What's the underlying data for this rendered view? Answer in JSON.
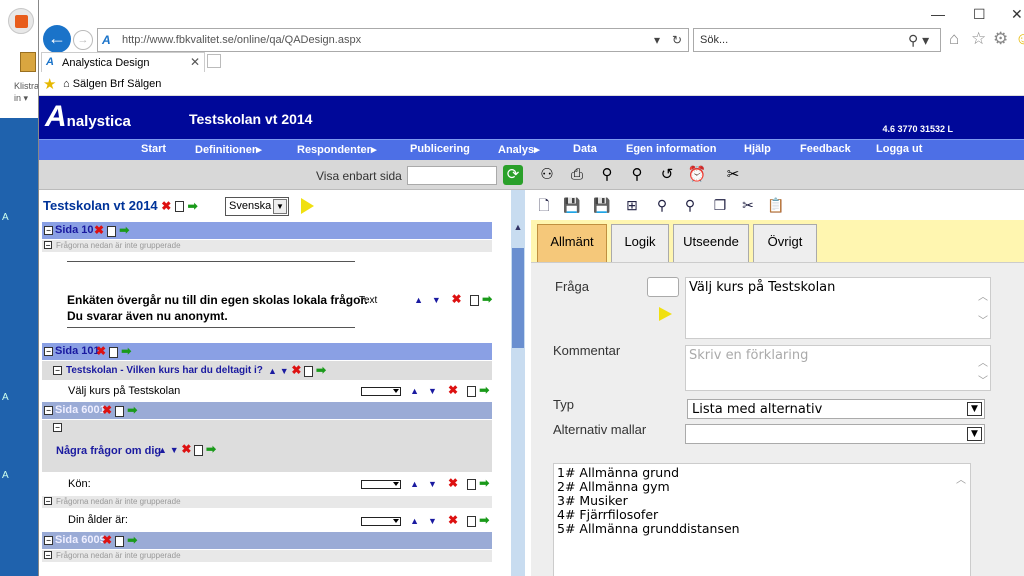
{
  "desktop": {
    "clip_label_1": "Klistra",
    "clip_label_2": "in",
    "side_letters": [
      "A",
      "A",
      "A"
    ]
  },
  "browser": {
    "address": "http://www.fbkvalitet.se/online/qa/QADesign.aspx",
    "search_placeholder": "Sök...",
    "tab_title": "Analystica Design",
    "favorite": "Sälgen  Brf Sälgen",
    "window_controls": {
      "minimize": "—",
      "maximize": "☐",
      "close": "✕"
    }
  },
  "app": {
    "logo": "nalystica",
    "logo_letter": "A",
    "title": "Testskolan vt 2014",
    "version": "4.6 3770 31532 L",
    "menu": [
      {
        "label": "Start"
      },
      {
        "label": "Definitioner",
        "arrow": "▸"
      },
      {
        "label": "Respondenter",
        "arrow": "▸"
      },
      {
        "label": "Publicering"
      },
      {
        "label": "Analys",
        "arrow": "▸"
      },
      {
        "label": "Data"
      },
      {
        "label": "Egen information"
      },
      {
        "label": "Hjälp"
      },
      {
        "label": "Feedback"
      },
      {
        "label": "Logga ut"
      }
    ],
    "toolbar_label": "Visa enbart sida"
  },
  "left": {
    "title": "Testskolan vt 2014",
    "language": "Svenska",
    "grouped_note": "Frågorna nedan är inte grupperade",
    "sida10": "Sida 10",
    "intro_line1": "Enkäten övergår nu till din egen skolas lokala frågor.",
    "intro_line2": "Du svarar även nu anonymt.",
    "text_label": "Text",
    "sida101": "Sida 101",
    "group_title": "Testskolan - Vilken kurs har du deltagit i?",
    "q_kurs": "Välj kurs på Testskolan",
    "sida6001": "Sida 6001",
    "group2_title": "Några frågor om dig",
    "q_kon": "Kön:",
    "q_alder": "Din ålder är:",
    "sida6009": "Sida 6009"
  },
  "right": {
    "tabs": [
      "Allmänt",
      "Logik",
      "Utseende",
      "Övrigt"
    ],
    "active_tab": "Allmänt",
    "fraga_label": "Fråga",
    "fraga_value": "Välj kurs på Testskolan",
    "kommentar_label": "Kommentar",
    "kommentar_placeholder": "Skriv en förklaring",
    "typ_label": "Typ",
    "typ_value": "Lista med alternativ",
    "mallar_label": "Alternativ mallar",
    "mallar_value": "",
    "alternatives": [
      "1# Allmänna grund",
      "2# Allmänna gym",
      "3# Musiker",
      "4# Fjärrfilosofer",
      "5# Allmänna grunddistansen"
    ]
  }
}
